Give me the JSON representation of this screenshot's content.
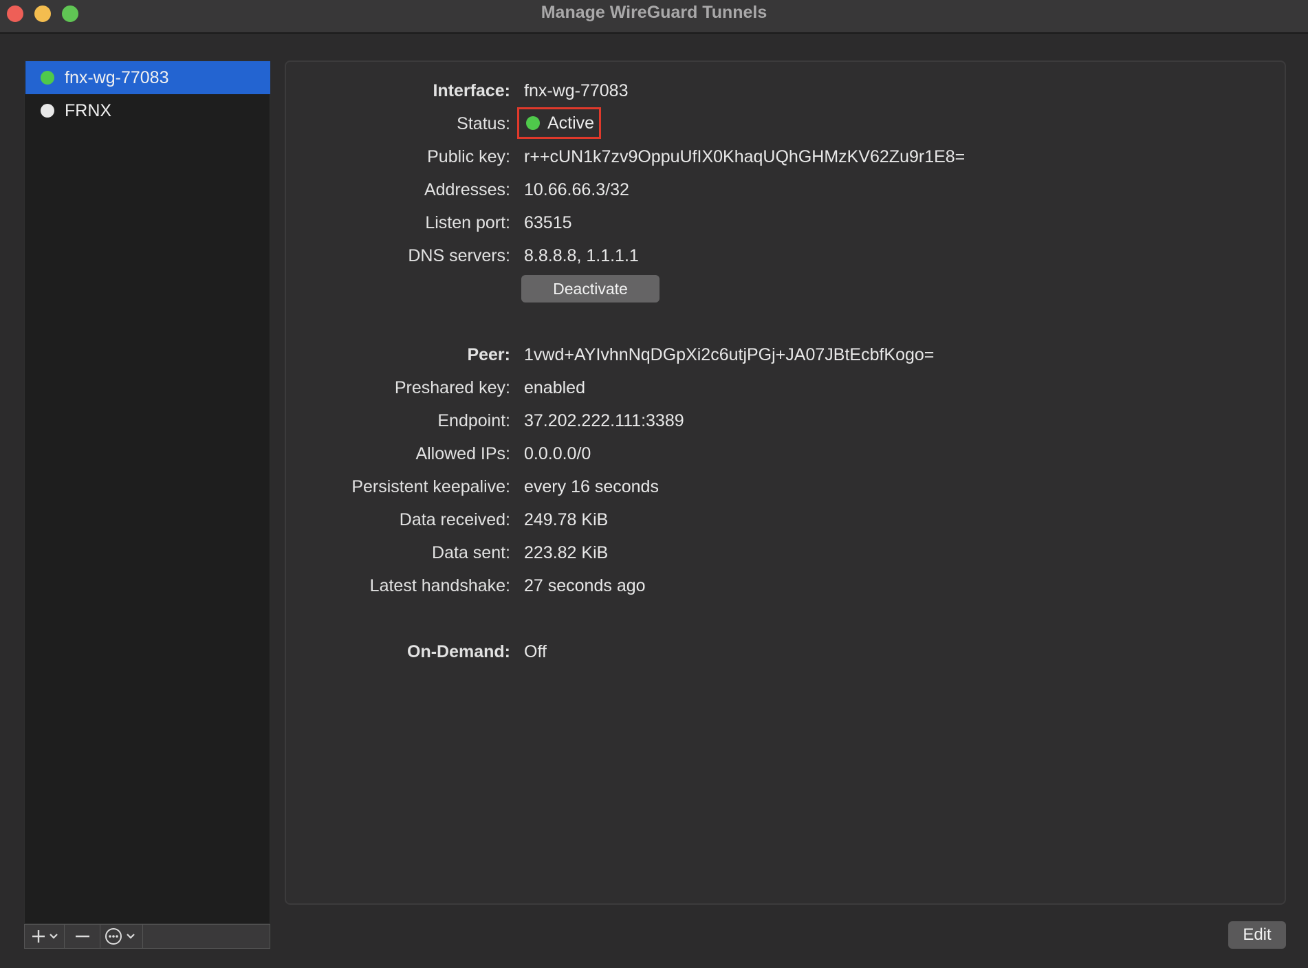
{
  "window": {
    "title": "Manage WireGuard Tunnels"
  },
  "sidebar": {
    "tunnels": [
      {
        "name": "fnx-wg-77083",
        "status": "active",
        "selected": true
      },
      {
        "name": "FRNX",
        "status": "inactive",
        "selected": false
      }
    ],
    "toolbar": {
      "add": "+",
      "remove": "—",
      "action": "⋯"
    }
  },
  "details": {
    "interface": {
      "label": "Interface:",
      "value": "fnx-wg-77083"
    },
    "status": {
      "label": "Status:",
      "value": "Active"
    },
    "public_key": {
      "label": "Public key:",
      "value": "r++cUN1k7zv9OppuUfIX0KhaqUQhGHMzKV62Zu9r1E8="
    },
    "addresses": {
      "label": "Addresses:",
      "value": "10.66.66.3/32"
    },
    "listen_port": {
      "label": "Listen port:",
      "value": "63515"
    },
    "dns_servers": {
      "label": "DNS servers:",
      "value": "8.8.8.8, 1.1.1.1"
    },
    "deactivate_label": "Deactivate",
    "peer": {
      "label": "Peer:",
      "value": "1vwd+AYIvhnNqDGpXi2c6utjPGj+JA07JBtEcbfKogo="
    },
    "preshared_key": {
      "label": "Preshared key:",
      "value": "enabled"
    },
    "endpoint": {
      "label": "Endpoint:",
      "value": "37.202.222.111:3389"
    },
    "allowed_ips": {
      "label": "Allowed IPs:",
      "value": "0.0.0.0/0"
    },
    "persistent_keepalive": {
      "label": "Persistent keepalive:",
      "value": "every 16 seconds"
    },
    "data_received": {
      "label": "Data received:",
      "value": "249.78 KiB"
    },
    "data_sent": {
      "label": "Data sent:",
      "value": "223.82 KiB"
    },
    "latest_handshake": {
      "label": "Latest handshake:",
      "value": "27 seconds ago"
    },
    "on_demand": {
      "label": "On-Demand:",
      "value": "Off"
    }
  },
  "footer": {
    "edit_label": "Edit"
  },
  "colors": {
    "accent": "#2364d1",
    "active_green": "#4fc94b",
    "highlight_red": "#e0392b"
  }
}
